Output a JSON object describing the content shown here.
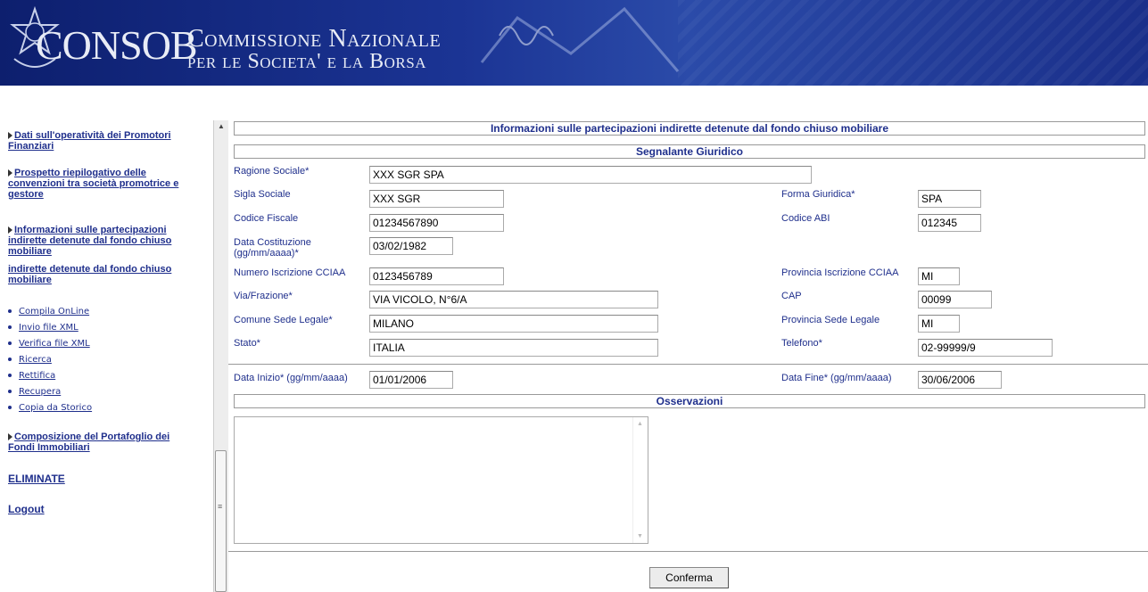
{
  "header": {
    "brand": "CONSOB",
    "subtitle_line1": "Commissione Nazionale",
    "subtitle_line2": "per le Societa' e la Borsa",
    "colors": {
      "banner": "#1b3494",
      "text": "#e8ecf6"
    }
  },
  "sidebar": {
    "links": [
      {
        "label": "Dati sull'operatività dei Promotori Finanziari"
      },
      {
        "label": "Prospetto riepilogativo delle convenzioni tra società promotrice e gestore"
      },
      {
        "label": "Informazioni sulle partecipazioni indirette detenute dal fondo chiuso mobiliare"
      },
      {
        "label": "indirette detenute dal fondo chiuso mobiliare"
      }
    ],
    "sub_items": [
      "Compila OnLine",
      "Invio file XML",
      "Verifica file XML",
      "Ricerca",
      "Rettifica",
      "Recupera",
      "Copia da Storico"
    ],
    "portfolio_link": "Composizione del Portafoglio dei Fondi Immobiliari",
    "eliminate": "ELIMINATE",
    "logout": "Logout"
  },
  "main": {
    "page_title": "Informazioni sulle partecipazioni indirette detenute dal fondo chiuso mobiliare",
    "section_segnalante": "Segnalante Giuridico",
    "section_observations": "Osservazioni",
    "fields": {
      "ragione_sociale": {
        "label": "Ragione Sociale*",
        "value": "XXX SGR SPA"
      },
      "sigla_sociale": {
        "label": "Sigla Sociale",
        "value": "XXX SGR"
      },
      "forma_giuridica": {
        "label": "Forma Giuridica*",
        "value": "SPA"
      },
      "codice_fiscale": {
        "label": "Codice Fiscale",
        "value": "01234567890"
      },
      "codice_abi": {
        "label": "Codice ABI",
        "value": "012345"
      },
      "data_costituzione": {
        "label_line1": "Data Costituzione",
        "label_line2": "(gg/mm/aaaa)*",
        "value": "03/02/1982"
      },
      "numero_ccia": {
        "label": "Numero Iscrizione CCIAA",
        "value": "0123456789"
      },
      "provincia_ccia": {
        "label": "Provincia Iscrizione CCIAA",
        "value": "MI"
      },
      "via": {
        "label": "Via/Frazione*",
        "value": "VIA VICOLO, N°6/A"
      },
      "cap": {
        "label": "CAP",
        "value": "00099"
      },
      "comune": {
        "label": "Comune Sede Legale*",
        "value": "MILANO"
      },
      "provincia_sede": {
        "label": "Provincia Sede Legale",
        "value": "MI"
      },
      "stato": {
        "label": "Stato*",
        "value": "ITALIA"
      },
      "telefono": {
        "label": "Telefono*",
        "value": "02-99999/9"
      },
      "data_inizio": {
        "label": "Data Inizio* (gg/mm/aaaa)",
        "value": "01/01/2006"
      },
      "data_fine": {
        "label": "Data Fine* (gg/mm/aaaa)",
        "value": "30/06/2006"
      }
    },
    "confirm_label": "Conferma"
  }
}
